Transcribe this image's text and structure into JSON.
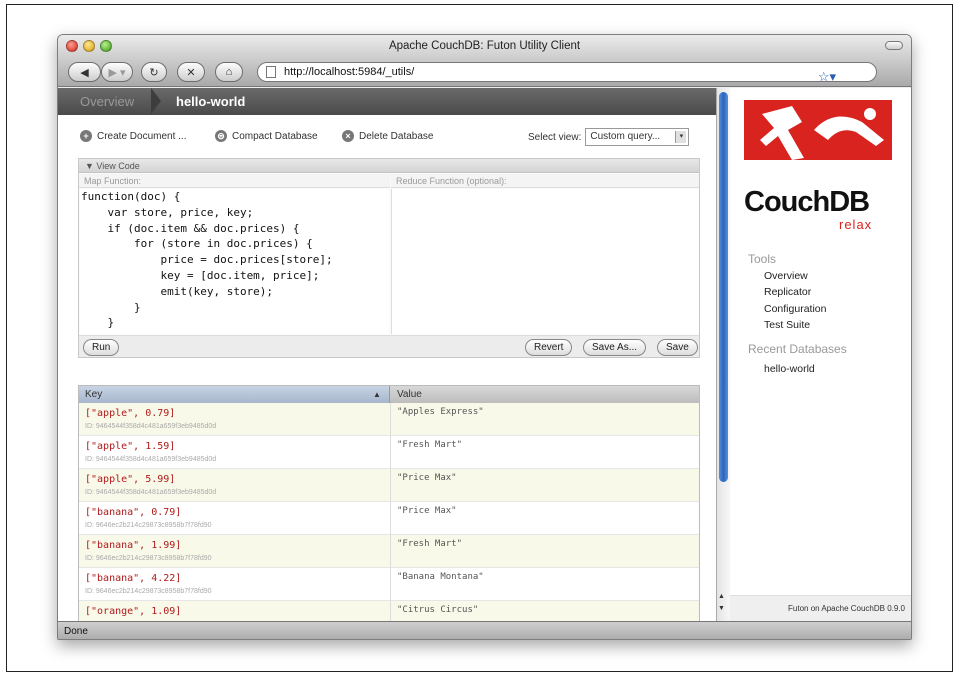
{
  "window": {
    "title": "Apache CouchDB: Futon Utility Client"
  },
  "browser": {
    "url": "http://localhost:5984/_utils/",
    "status": "Done"
  },
  "breadcrumb": {
    "overview": "Overview",
    "current": "hello-world"
  },
  "actions": {
    "create": "Create Document ...",
    "compact": "Compact Database",
    "delete": "Delete Database",
    "select_label": "Select view:",
    "select_value": "Custom query..."
  },
  "view_code": {
    "toggle_label": "▼ View Code",
    "map_label": "Map Function:",
    "reduce_label": "Reduce Function (optional):",
    "map_code": "function(doc) {\n    var store, price, key;\n    if (doc.item && doc.prices) {\n        for (store in doc.prices) {\n            price = doc.prices[store];\n            key = [doc.item, price];\n            emit(key, store);\n        }\n    }\n}",
    "run": "Run",
    "revert": "Revert",
    "save_as": "Save As...",
    "save": "Save"
  },
  "results": {
    "col_key": "Key",
    "col_value": "Value",
    "rows": [
      {
        "key": "[\"apple\", 0.79]",
        "id": "ID: 9464544f358d4c481a659f3eb9485d0d",
        "value": "\"Apples Express\""
      },
      {
        "key": "[\"apple\", 1.59]",
        "id": "ID: 9464544f358d4c481a659f3eb9485d0d",
        "value": "\"Fresh Mart\""
      },
      {
        "key": "[\"apple\", 5.99]",
        "id": "ID: 9464544f358d4c481a659f3eb9485d0d",
        "value": "\"Price Max\""
      },
      {
        "key": "[\"banana\", 0.79]",
        "id": "ID: 9646ec2b214c29873c8958b7f78fd90",
        "value": "\"Price Max\""
      },
      {
        "key": "[\"banana\", 1.99]",
        "id": "ID: 9646ec2b214c29873c8958b7f78fd90",
        "value": "\"Fresh Mart\""
      },
      {
        "key": "[\"banana\", 4.22]",
        "id": "ID: 9646ec2b214c29873c8958b7f78fd90",
        "value": "\"Banana Montana\""
      },
      {
        "key": "[\"orange\", 1.09]",
        "id": "",
        "value": "\"Citrus Circus\""
      }
    ]
  },
  "sidebar": {
    "logo_text": "CouchDB",
    "tagline": "relax",
    "tools_title": "Tools",
    "tools": [
      "Overview",
      "Replicator",
      "Configuration",
      "Test Suite"
    ],
    "recent_title": "Recent Databases",
    "recent": [
      "hello-world"
    ],
    "footer": "Futon on Apache CouchDB 0.9.0"
  },
  "colors": {
    "brand_red": "#d9231f",
    "key_red": "#b01c1c",
    "scroll_blue": "#2a64c0"
  }
}
